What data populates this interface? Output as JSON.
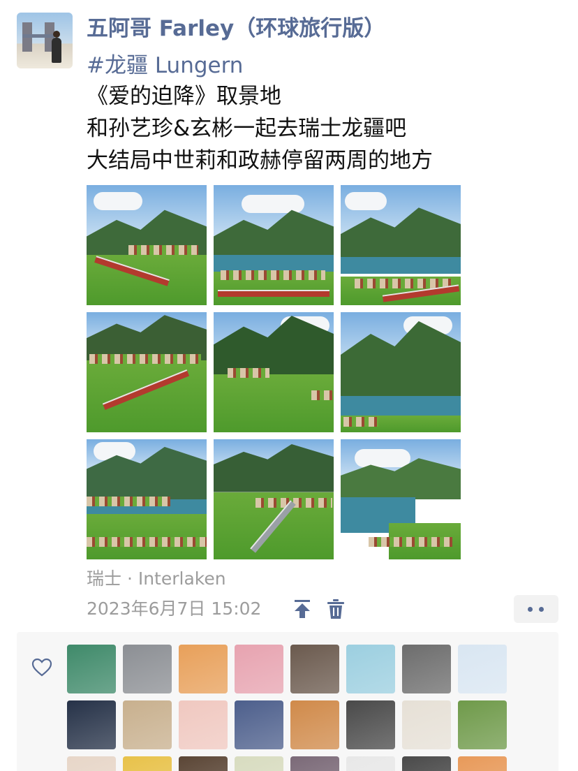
{
  "post": {
    "author": "五阿哥 Farley（环球旅行版）",
    "hashtag": "#龙疆 Lungern",
    "lines": [
      "《爱的迫降》取景地",
      "和孙艺珍&玄彬一起去瑞士龙疆吧",
      "大结局中世莉和政赫停留两周的地方"
    ],
    "location": "瑞士 · Interlaken",
    "timestamp": "2023年6月7日 15:02"
  },
  "icons": {
    "pin": "pin-to-top-icon",
    "trash": "trash-icon",
    "more": "more-dots-icon",
    "like": "heart-icon"
  },
  "colors": {
    "link": "#576b95",
    "meta_text": "#9c9c9c",
    "panel_bg": "#f7f7f7"
  },
  "likers": [
    "#3f8a6a",
    "#8c8f94",
    "#e8a05a",
    "#e7a3b0",
    "#6b5a4e",
    "#9ccfe0",
    "#6d6d6d",
    "#d9e6f2",
    "#263248",
    "#c8b08e",
    "#f0c8c0",
    "#4d5f8c",
    "#d08a4a",
    "#4a4a4a",
    "#e6e0d6",
    "#6f9a4a",
    "#e7d6c8",
    "#e8c24a",
    "#5b4636",
    "#d8dcc0",
    "#7b6a78",
    "#e8e8e8",
    "#4a4a4a",
    "#e89a5a"
  ]
}
